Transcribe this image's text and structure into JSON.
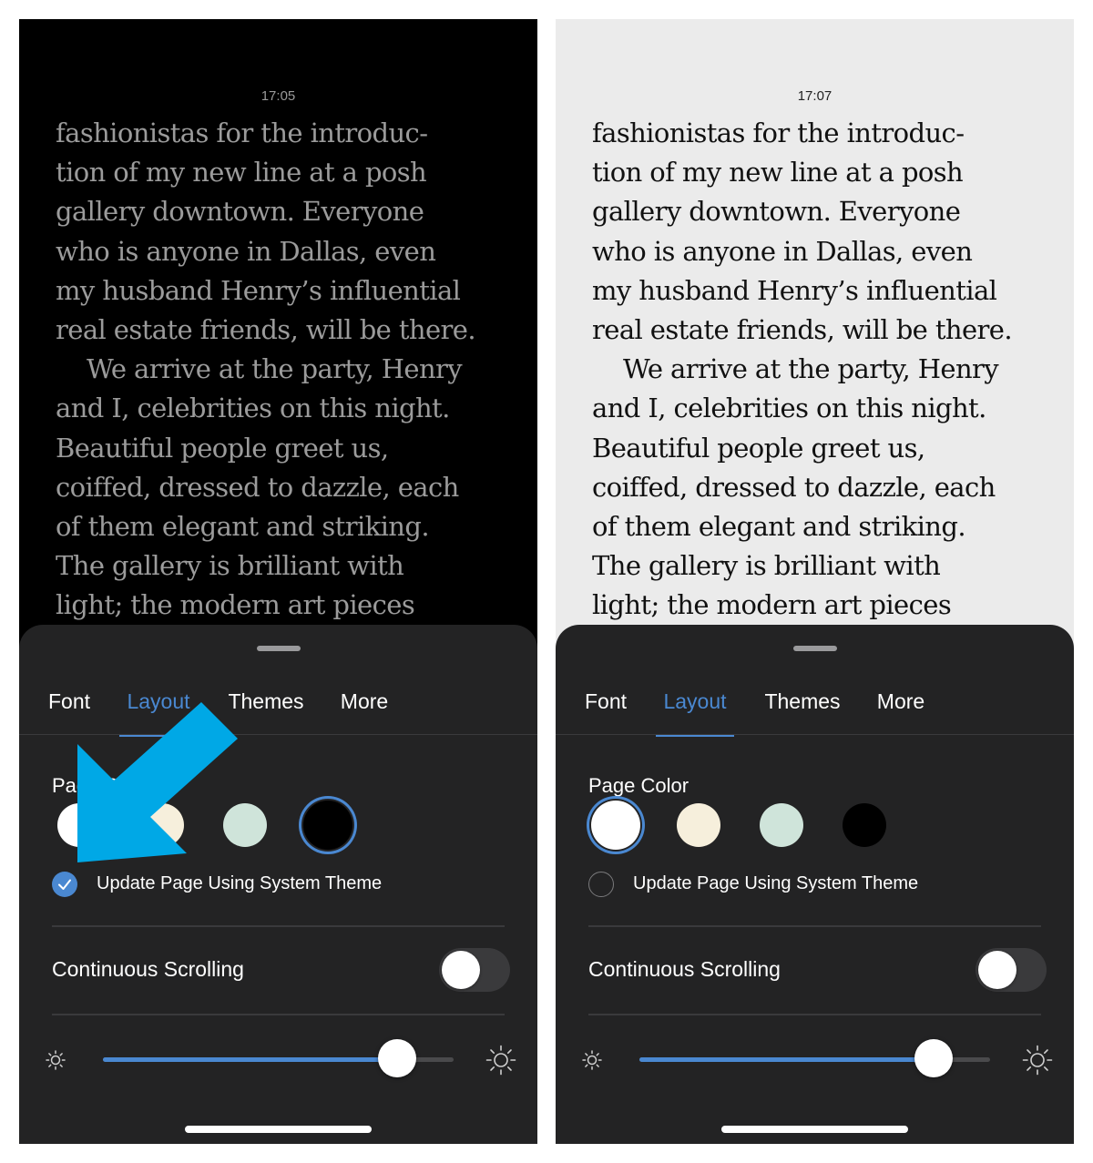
{
  "book_lines": [
    "fashionistas for the introduc-",
    "tion of my new line at a posh",
    "gallery downtown. Everyone",
    "who is anyone in Dallas, even",
    "my husband Henry’s influential",
    "real estate friends, will be there.",
    "We arrive at the party, Henry",
    "and I, celebrities on this night.",
    "Beautiful people greet us,",
    "coiffed, dressed to dazzle, each",
    "of them elegant and striking.",
    "The gallery is brilliant with",
    "light; the modern art pieces"
  ],
  "colors": {
    "accent": "#4a88d1",
    "sheet_bg": "#232324",
    "arrow": "#00a8e6"
  },
  "left": {
    "time": "17:05",
    "page_bg": "#000000",
    "tabs": [
      {
        "label": "Font",
        "active": false
      },
      {
        "label": "Layout",
        "active": true
      },
      {
        "label": "Themes",
        "active": false
      },
      {
        "label": "More",
        "active": false
      }
    ],
    "page_color_label": "Page Color",
    "swatches": [
      {
        "name": "white",
        "color": "#ffffff",
        "selected": false
      },
      {
        "name": "sepia",
        "color": "#f6efdc",
        "selected": false
      },
      {
        "name": "mint",
        "color": "#cfe4da",
        "selected": false
      },
      {
        "name": "black",
        "color": "#000000",
        "selected": true
      }
    ],
    "system_theme_label": "Update Page Using System Theme",
    "system_theme_checked": true,
    "continuous_scrolling_label": "Continuous Scrolling",
    "continuous_scrolling_on": false,
    "brightness": 0.84,
    "arrow_icon": "arrow-pointing-down-left-icon"
  },
  "right": {
    "time": "17:07",
    "page_bg": "#ebebeb",
    "tabs": [
      {
        "label": "Font",
        "active": false
      },
      {
        "label": "Layout",
        "active": true
      },
      {
        "label": "Themes",
        "active": false
      },
      {
        "label": "More",
        "active": false
      }
    ],
    "page_color_label": "Page Color",
    "swatches": [
      {
        "name": "white",
        "color": "#ffffff",
        "selected": true
      },
      {
        "name": "sepia",
        "color": "#f6efdc",
        "selected": false
      },
      {
        "name": "mint",
        "color": "#cfe4da",
        "selected": false
      },
      {
        "name": "black",
        "color": "#000000",
        "selected": false
      }
    ],
    "system_theme_label": "Update Page Using System Theme",
    "system_theme_checked": false,
    "continuous_scrolling_label": "Continuous Scrolling",
    "continuous_scrolling_on": false,
    "brightness": 0.84
  }
}
